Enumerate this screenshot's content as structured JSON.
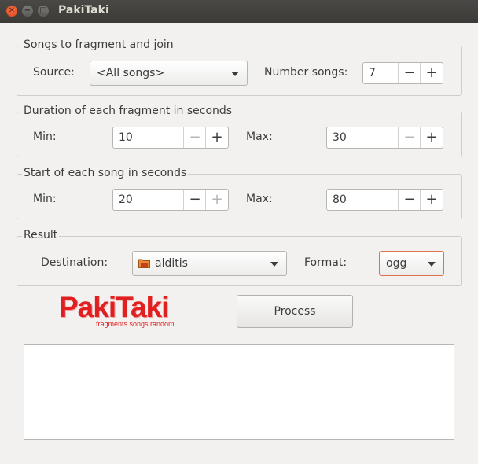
{
  "window": {
    "title": "PakiTaki"
  },
  "songs_group": {
    "title": "Songs to fragment and join",
    "source_label": "Source:",
    "source_value": "<All songs>",
    "number_label": "Number songs:",
    "number_value": "7"
  },
  "duration_group": {
    "title": "Duration of each fragment in seconds",
    "min_label": "Min:",
    "min_value": "10",
    "max_label": "Max:",
    "max_value": "30"
  },
  "start_group": {
    "title": "Start of each song in seconds",
    "min_label": "Min:",
    "min_value": "20",
    "max_label": "Max:",
    "max_value": "80"
  },
  "result_group": {
    "title": "Result",
    "destination_label": "Destination:",
    "destination_value": "alditis",
    "format_label": "Format:",
    "format_value": "ogg"
  },
  "spin_symbols": {
    "minus": "−",
    "plus": "+"
  },
  "logo": {
    "name": "PakiTaki",
    "tagline": "fragments songs random"
  },
  "process_button": "Process",
  "colors": {
    "logo_red": "#e02020",
    "titlebar": "#3b3a37",
    "close_button": "#e0461a",
    "format_border": "#e0734d"
  }
}
